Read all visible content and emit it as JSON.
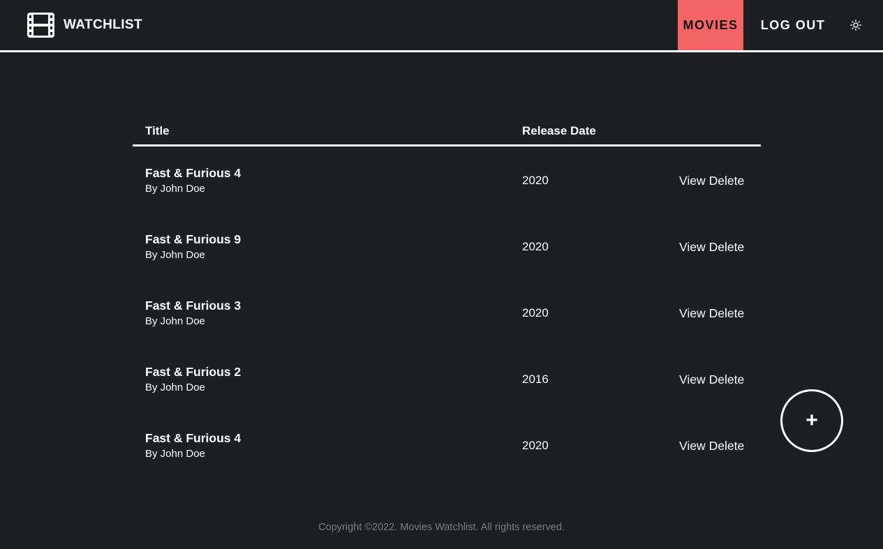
{
  "app": {
    "brand": "WATCHLIST",
    "brand_icon": "film-icon",
    "accent_color": "#f56565",
    "background_color": "#1d1f22"
  },
  "nav": {
    "movies_label": "MOVIES",
    "logout_label": "LOG OUT",
    "theme_icon": "sun-icon"
  },
  "table": {
    "columns": [
      "Title",
      "Release Date"
    ],
    "rows": [
      {
        "title": "Fast & Furious 4",
        "author": "By John Doe",
        "release": "2020",
        "view": "View",
        "delete": "Delete"
      },
      {
        "title": "Fast & Furious 9",
        "author": "By John Doe",
        "release": "2020",
        "view": "View",
        "delete": "Delete"
      },
      {
        "title": "Fast & Furious 3",
        "author": "By John Doe",
        "release": "2020",
        "view": "View",
        "delete": "Delete"
      },
      {
        "title": "Fast & Furious 2",
        "author": "By John Doe",
        "release": "2016",
        "view": "View",
        "delete": "Delete"
      },
      {
        "title": "Fast & Furious 4",
        "author": "By John Doe",
        "release": "2020",
        "view": "View",
        "delete": "Delete"
      }
    ]
  },
  "fab": {
    "label": "+",
    "icon": "plus-icon"
  },
  "footer": {
    "copyright": "Copyright ©2022. Movies Watchlist. All rights reserved."
  }
}
